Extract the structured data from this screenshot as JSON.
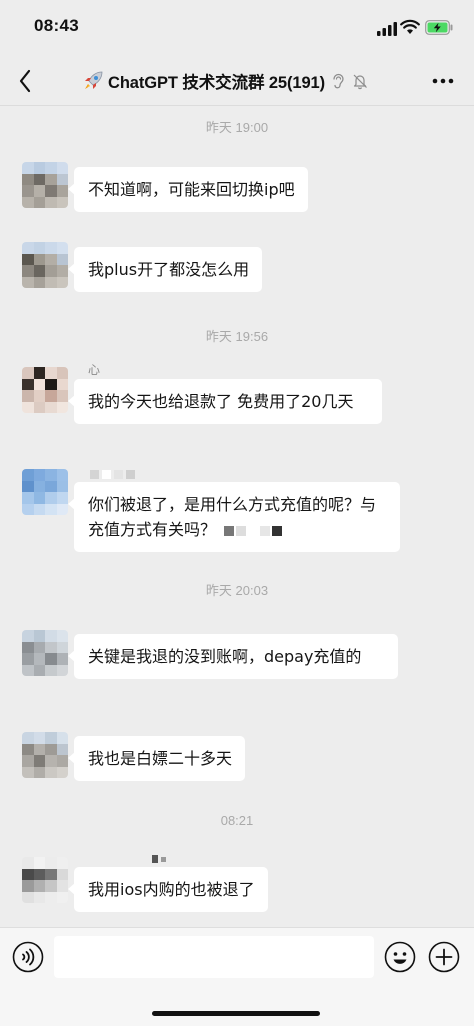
{
  "status_bar": {
    "time": "08:43",
    "icons": [
      "cellular-signal-icon",
      "wifi-icon",
      "battery-charging-icon"
    ],
    "battery_color": "#4cd964"
  },
  "header": {
    "back_icon": "chevron-left-icon",
    "title": "ChatGPT 技术交流群 25(191)",
    "title_emoji": "rocket-emoji",
    "status_icons": [
      "ear-icon",
      "mute-bell-icon"
    ],
    "more_icon": "more-dots-icon"
  },
  "messages": {
    "divider_1": "昨天 19:00",
    "msg_1": "不知道啊，可能来回切换ip吧",
    "msg_2": "我plus开了都没怎么用",
    "divider_2": "昨天 19:56",
    "msg_3_name": "心",
    "msg_3": "我的今天也给退款了  免费用了20几天",
    "msg_4": "你们被退了，是用什么方式充值的呢？与充值方式有关吗？",
    "divider_3": "昨天 20:03",
    "msg_5": "关键是我退的没到账啊，depay充值的",
    "msg_6": "我也是白嫖二十多天",
    "divider_4": "08:21",
    "msg_7": "我用ios内购的也被退了"
  },
  "input_bar": {
    "voice_icon": "voice-icon",
    "emoji_icon": "emoji-icon",
    "plus_icon": "plus-icon",
    "value": "",
    "placeholder": ""
  },
  "colors": {
    "background": "#ededed",
    "bubble": "#ffffff",
    "time_divider": "#a9a9a9"
  }
}
